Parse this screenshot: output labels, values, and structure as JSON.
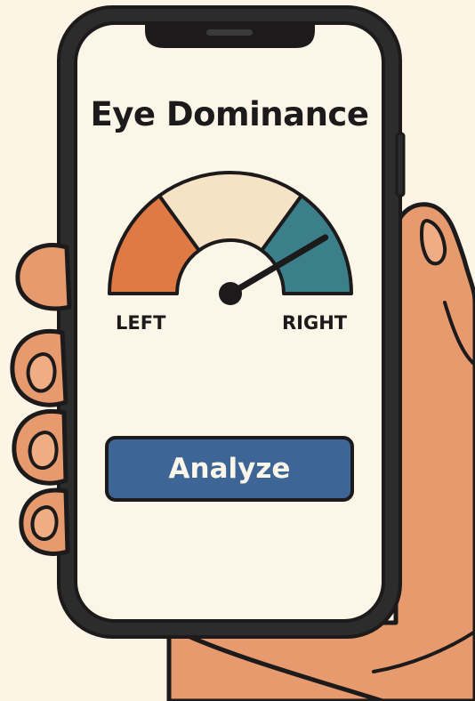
{
  "screen": {
    "title": "Eye Dominance"
  },
  "gauge": {
    "left_label": "LEFT",
    "right_label": "RIGHT",
    "reading": 0.83,
    "segments": [
      {
        "color": "#e07a45"
      },
      {
        "color": "#f6e3c5"
      },
      {
        "color": "#3a7f8a"
      }
    ]
  },
  "actions": {
    "analyze_label": "Analyze"
  },
  "colors": {
    "background": "#fcf5e6",
    "screen": "#fcf6e8",
    "phone_frame": "#2c2c2c",
    "skin": "#e79a6e",
    "outline": "#1c1a1a",
    "button": "#3d6596",
    "button_text": "#fbf6ea"
  }
}
